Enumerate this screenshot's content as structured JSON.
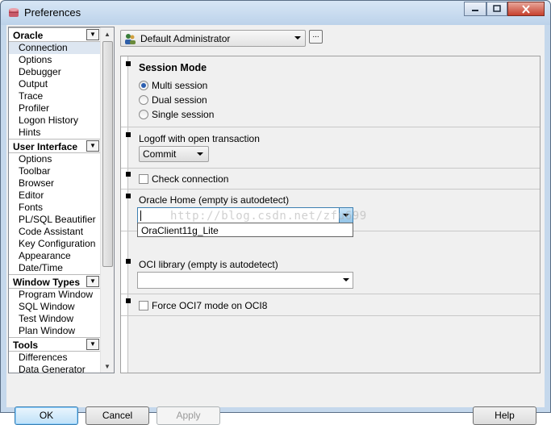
{
  "window": {
    "title": "Preferences"
  },
  "tree": {
    "groups": [
      {
        "label": "Oracle",
        "items": [
          "Connection",
          "Options",
          "Debugger",
          "Output",
          "Trace",
          "Profiler",
          "Logon History",
          "Hints"
        ]
      },
      {
        "label": "User Interface",
        "items": [
          "Options",
          "Toolbar",
          "Browser",
          "Editor",
          "Fonts",
          "PL/SQL Beautifier",
          "Code Assistant",
          "Key Configuration",
          "Appearance",
          "Date/Time"
        ]
      },
      {
        "label": "Window Types",
        "items": [
          "Program Window",
          "SQL Window",
          "Test Window",
          "Plan Window"
        ]
      },
      {
        "label": "Tools",
        "items": [
          "Differences",
          "Data Generator"
        ]
      }
    ],
    "selected": "Connection"
  },
  "profile": {
    "value": "Default Administrator",
    "more_label": "..."
  },
  "session_mode": {
    "title": "Session Mode",
    "options": [
      "Multi session",
      "Dual session",
      "Single session"
    ],
    "selected": "Multi session"
  },
  "logoff": {
    "label": "Logoff with open transaction",
    "value": "Commit"
  },
  "check_connection": {
    "label": "Check connection",
    "checked": false
  },
  "oracle_home": {
    "label": "Oracle Home (empty is autodetect)",
    "value": "",
    "dropdown_option": "OraClient11g_Lite"
  },
  "oci_library": {
    "label": "OCI library (empty is autodetect)",
    "value": ""
  },
  "force_oci7": {
    "label": "Force OCI7 mode on OCI8",
    "checked": false
  },
  "watermark": "http://blog.csdn.net/zfu699",
  "buttons": {
    "ok": "OK",
    "cancel": "Cancel",
    "apply": "Apply",
    "help": "Help"
  },
  "colors": {
    "accent": "#3c7fb1",
    "selection": "#dde6f1",
    "frame": "#c5d8ec",
    "close": "#c7402d"
  }
}
